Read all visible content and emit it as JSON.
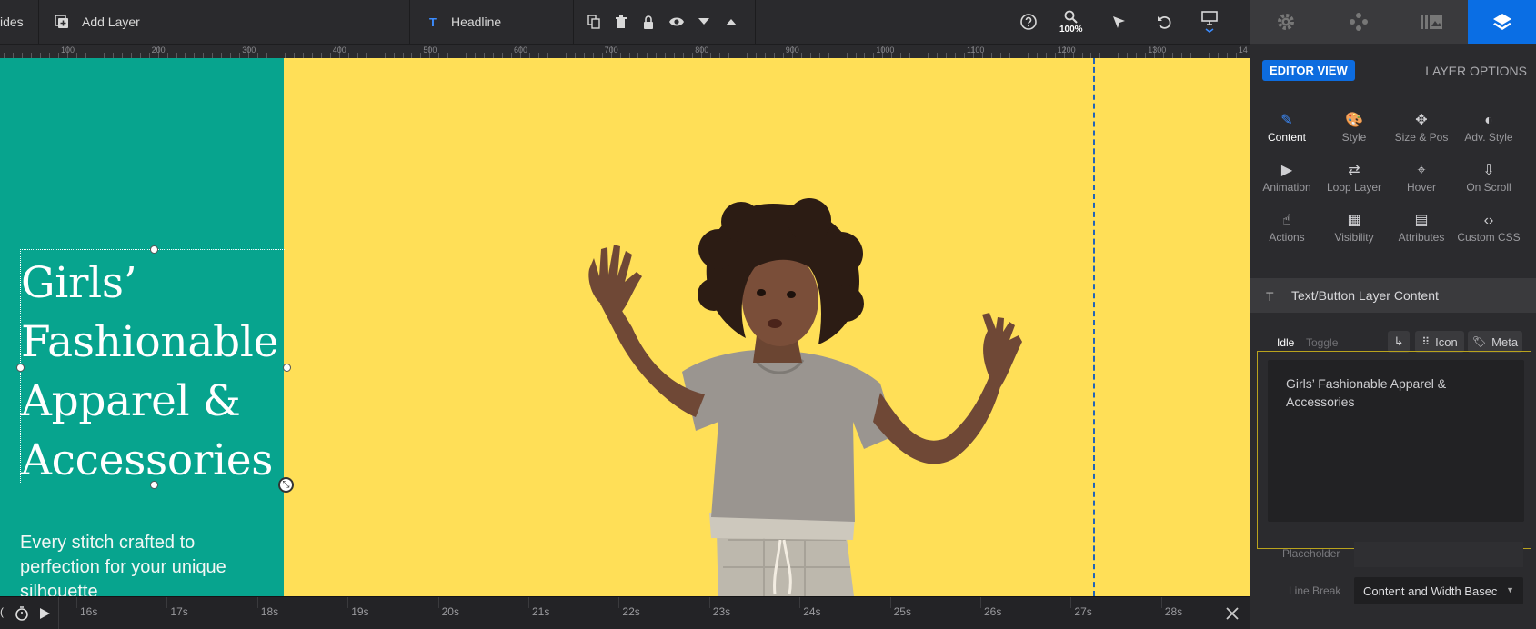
{
  "toolbar": {
    "slides_label": "ides",
    "add_layer_label": "Add Layer",
    "layer_name": "Headline",
    "zoom_level": "100%"
  },
  "ruler": {
    "labels": [
      "100",
      "200",
      "300",
      "400",
      "500",
      "600",
      "700",
      "800",
      "900",
      "1000",
      "1100",
      "1200",
      "1300",
      "14"
    ]
  },
  "canvas": {
    "headline": "Girls’ Fashionable Apparel & Accessories",
    "subtext": "Every stitch crafted to perfection for your unique silhouette",
    "bg_color": "#ffdf57",
    "panel_color": "#07a48e"
  },
  "timeline": {
    "labels": [
      "16s",
      "17s",
      "18s",
      "19s",
      "20s",
      "21s",
      "22s",
      "23s",
      "24s",
      "25s",
      "26s",
      "27s",
      "28s"
    ]
  },
  "panel": {
    "editor_view": "EDITOR VIEW",
    "layer_options": "LAYER OPTIONS",
    "tabs": [
      {
        "label": "Content",
        "icon": "pencil-icon",
        "glyph": "✎"
      },
      {
        "label": "Style",
        "icon": "palette-icon",
        "glyph": "🎨"
      },
      {
        "label": "Size & Pos",
        "icon": "move-icon",
        "glyph": "✥"
      },
      {
        "label": "Adv. Style",
        "icon": "contrast-icon",
        "glyph": "◐"
      },
      {
        "label": "Animation",
        "icon": "play-icon",
        "glyph": "▶"
      },
      {
        "label": "Loop Layer",
        "icon": "loop-icon",
        "glyph": "⇄"
      },
      {
        "label": "Hover",
        "icon": "mouse-icon",
        "glyph": "⌖"
      },
      {
        "label": "On Scroll",
        "icon": "scroll-icon",
        "glyph": "⇩"
      },
      {
        "label": "Actions",
        "icon": "pointer-icon",
        "glyph": "☝"
      },
      {
        "label": "Visibility",
        "icon": "visibility-icon",
        "glyph": "▦"
      },
      {
        "label": "Attributes",
        "icon": "document-icon",
        "glyph": "▤"
      },
      {
        "label": "Custom CSS",
        "icon": "code-icon",
        "glyph": "‹›"
      }
    ],
    "section_title": "Text/Button Layer Content",
    "idle_label": "Idle",
    "toggle_label": "Toggle",
    "icon_label": "Icon",
    "meta_label": "Meta",
    "content_text": "Girls’ Fashionable Apparel & Accessories",
    "placeholder_label": "Placeholder",
    "line_break_label": "Line Break",
    "line_break_value": "Content and Width Basec"
  }
}
